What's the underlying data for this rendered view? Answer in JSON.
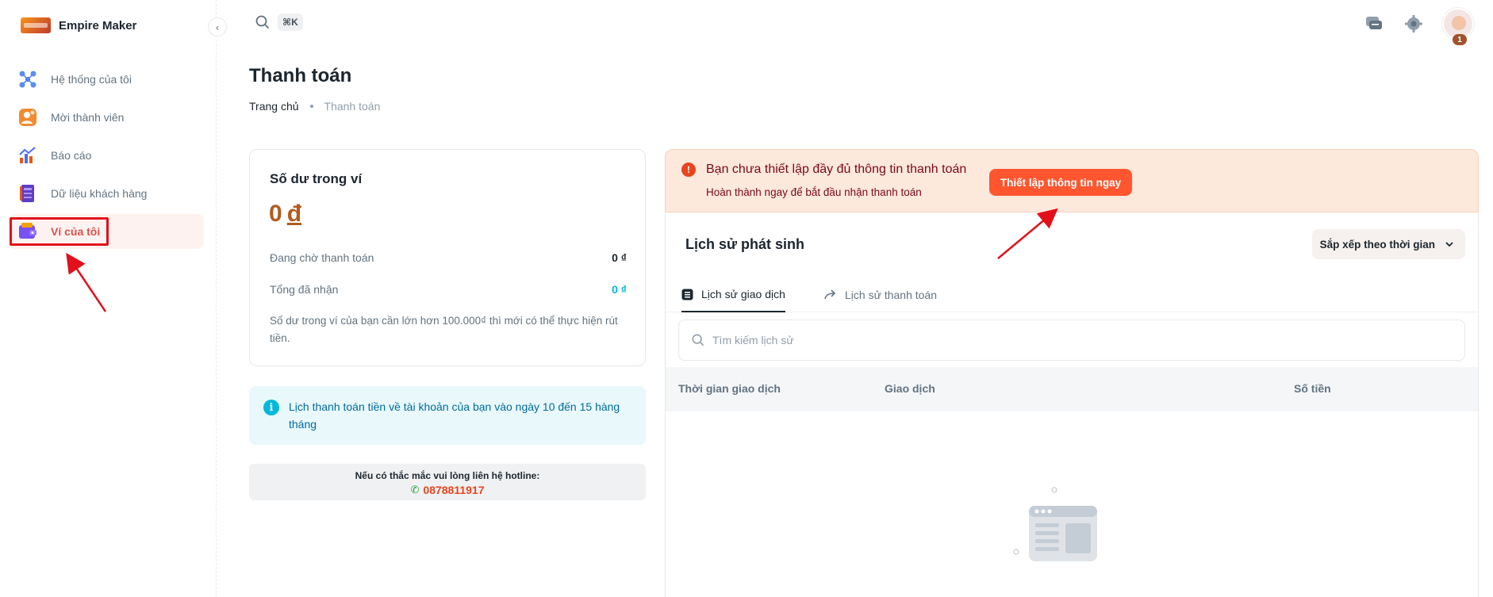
{
  "brand": {
    "name": "Empire Maker"
  },
  "sidebar": {
    "items": [
      {
        "label": "Hệ thống của tôi",
        "icon": "network-icon"
      },
      {
        "label": "Mời thành viên",
        "icon": "invite-member-icon"
      },
      {
        "label": "Báo cáo",
        "icon": "report-chart-icon"
      },
      {
        "label": "Dữ liệu khách hàng",
        "icon": "customer-data-icon"
      },
      {
        "label": "Ví của tôi",
        "icon": "wallet-icon",
        "active": true
      }
    ]
  },
  "topbar": {
    "shortcut": "⌘K",
    "avatar_badge": "1"
  },
  "page": {
    "title": "Thanh toán",
    "breadcrumb": {
      "home": "Trang chủ",
      "current": "Thanh toán"
    }
  },
  "wallet": {
    "title": "Số dư trong ví",
    "amount": "0",
    "currency": "đ",
    "pending_label": "Đang chờ thanh toán",
    "pending_value": "0 ₫",
    "received_label": "Tổng đã nhận",
    "received_value": "0 ₫",
    "note": "Số dư trong ví của bạn cần lớn hơn 100.000₫ thì mới có thể thực hiện rút tiền."
  },
  "info": {
    "text": "Lịch thanh toán tiền về tài khoản của bạn vào ngày 10 đến 15 hàng tháng"
  },
  "hotline": {
    "label": "Nếu có thắc mắc vui lòng liên hệ hotline:",
    "number": "0878811917"
  },
  "alert": {
    "title": "Bạn chưa thiết lập đầy đủ thông tin thanh toán",
    "subtitle": "Hoàn thành ngay để bắt đầu nhận thanh toán",
    "button": "Thiết lập thông tin ngay"
  },
  "history": {
    "title": "Lịch sử phát sinh",
    "sort_label": "Sắp xếp theo thời gian",
    "tabs": [
      {
        "label": "Lịch sử giao dịch"
      },
      {
        "label": "Lịch sử thanh toán"
      }
    ],
    "search_placeholder": "Tìm kiếm lịch sử",
    "columns": [
      "Thời gian giao dịch",
      "Giao dịch",
      "Số tiền"
    ]
  },
  "colors": {
    "accent": "#ff5630",
    "annotation": "#e1101a",
    "info": "#00b8d9",
    "wallet_amount": "#b35c1e"
  }
}
